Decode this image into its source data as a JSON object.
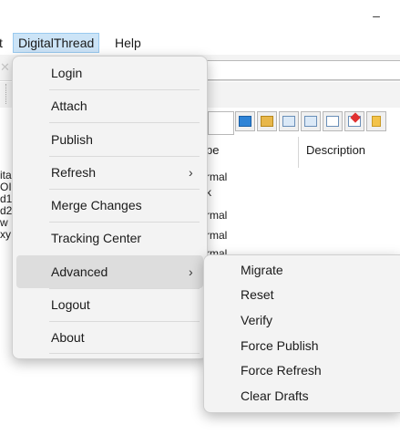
{
  "window": {
    "minimize_glyph": "–"
  },
  "menubar": {
    "cut_label": "t",
    "items": [
      {
        "label": "DigitalThread"
      },
      {
        "label": "Help"
      }
    ]
  },
  "grid": {
    "columns": [
      {
        "label": "pe"
      },
      {
        "label": "Description"
      }
    ],
    "left_fragments": [
      "ita",
      "OI",
      "d1",
      "d2",
      "w",
      "xy"
    ],
    "type_fragments": [
      "rmal",
      "k",
      "rmal",
      "rmal",
      "rmal"
    ]
  },
  "dropdown": {
    "items": [
      {
        "label": "Login"
      },
      {
        "label": "Attach"
      },
      {
        "label": "Publish"
      },
      {
        "label": "Refresh",
        "arrow": "›"
      },
      {
        "label": "Merge Changes"
      },
      {
        "label": "Tracking Center"
      },
      {
        "label": "Advanced",
        "arrow": "›"
      },
      {
        "label": "Logout"
      },
      {
        "label": "About"
      }
    ]
  },
  "submenu": {
    "items": [
      {
        "label": "Migrate"
      },
      {
        "label": "Reset"
      },
      {
        "label": "Verify"
      },
      {
        "label": "Force Publish"
      },
      {
        "label": "Force Refresh"
      },
      {
        "label": "Clear Drafts"
      }
    ]
  },
  "toolbar": {
    "icons": [
      "folder-blue-icon",
      "folder-icon",
      "document-grid-icon",
      "document-link-icon",
      "document-icon",
      "document-delete-icon",
      "sun-icon"
    ]
  }
}
